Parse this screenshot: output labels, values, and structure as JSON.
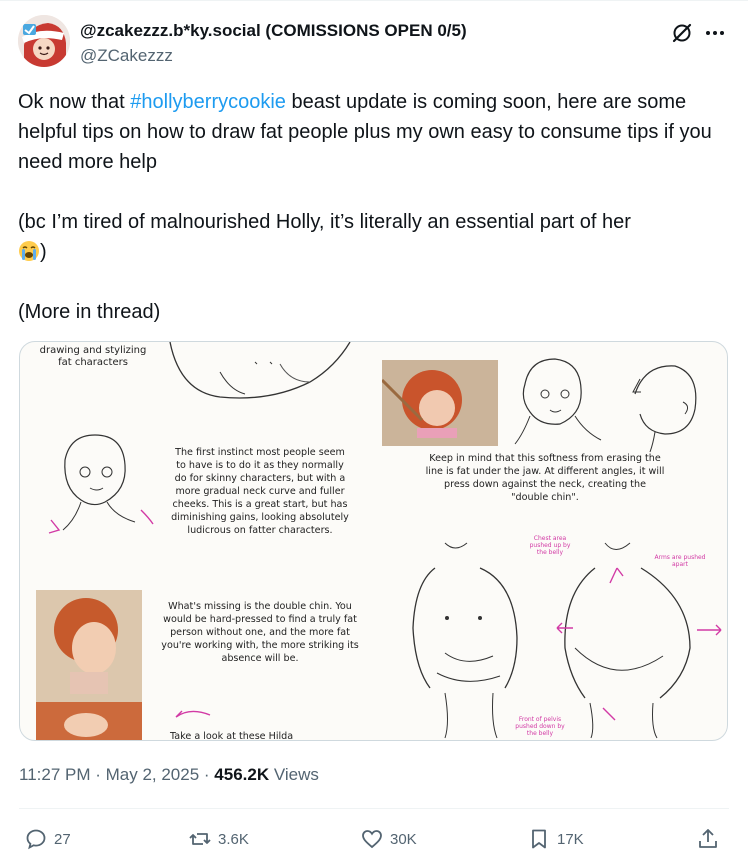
{
  "post": {
    "author": {
      "display_name": "@zcakezzz.b*ky.social (COMISSIONS OPEN 0/5)",
      "handle": "@ZCakezzz"
    },
    "text": {
      "p1_before": "Ok now that ",
      "hashtag": "#hollyberrycookie",
      "p1_after": " beast update is coming soon, here are some helpful tips on how to draw fat people plus my own easy to consume tips if you need more help",
      "p2": "(bc I’m tired of malnourished Holly, it’s literally an essential part of her",
      "p2_end": ")",
      "p3": "(More in thread)"
    },
    "media": {
      "title_line1": "drawing and stylizing",
      "title_line2": "fat characters",
      "note1": "The first instinct most people seem to have is to do it as they normally do for skinny characters, but with a more gradual neck curve and fuller cheeks. This is a great start, but has diminishing gains, looking absolutely ludicrous on fatter characters.",
      "note2": "Keep in mind that this softness from erasing the line is fat under the jaw. At different angles, it will press down against the neck, creating the \"double chin\".",
      "note3": "What's missing is the double chin. You would be hard-pressed to find a truly fat person without one, and the more fat you're working with, the more striking its absence will be.",
      "note4": "Take a look at these Hilda",
      "label_chest": "Chest area pushed up by the belly",
      "label_arms": "Arms are pushed apart",
      "label_pelvis": "Front of pelvis pushed down by the belly"
    },
    "timestamp": "11:27 PM · May 2, 2025",
    "separator": " · ",
    "views_count": "456.2K",
    "views_label": " Views",
    "actions": {
      "replies": "27",
      "reposts": "3.6K",
      "likes": "30K",
      "bookmarks": "17K"
    }
  },
  "colors": {
    "link": "#1d9bf0",
    "secondary_text": "#536471",
    "annotation_pink": "#d23aa5"
  }
}
